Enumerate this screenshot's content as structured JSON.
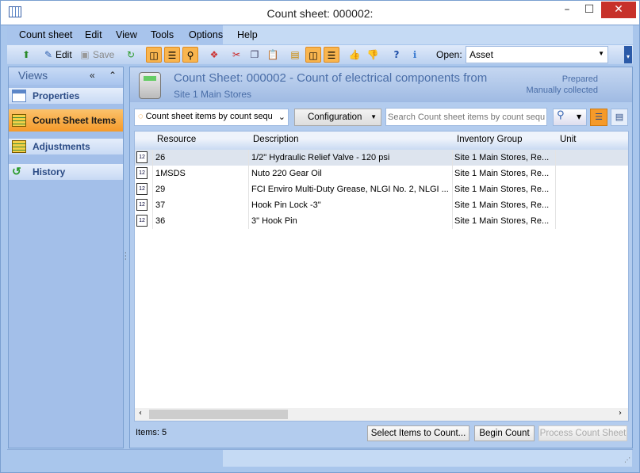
{
  "window": {
    "title": "Count sheet: 000002:",
    "minimize": "–",
    "maximize": "☐",
    "close": "✕"
  },
  "menu": [
    "Count sheet",
    "Edit",
    "View",
    "Tools",
    "Options",
    "Help"
  ],
  "toolbar": {
    "edit": "Edit",
    "save": "Save",
    "open_label": "Open:",
    "open_value": "Asset"
  },
  "views": {
    "title": "Views",
    "items": [
      "Properties",
      "Count Sheet Items",
      "Adjustments",
      "History"
    ]
  },
  "header": {
    "title": "Count Sheet: 000002 - Count of electrical components from",
    "subtitle": "Site 1 Main Stores",
    "status1": "Prepared",
    "status2": "Manually collected"
  },
  "filter": {
    "view_select": "Count sheet items by count sequ",
    "configuration": "Configuration",
    "search_placeholder": "Search Count sheet items by count sequence"
  },
  "grid": {
    "columns": [
      "Resource",
      "Description",
      "Inventory Group",
      "Unit"
    ],
    "rows": [
      {
        "resource": "26",
        "description": "1/2\" Hydraulic Relief Valve - 120 psi",
        "group": "Site 1 Main Stores, Re...",
        "unit": ""
      },
      {
        "resource": "1MSDS",
        "description": "Nuto 220 Gear Oil",
        "group": "Site 1 Main Stores, Re...",
        "unit": ""
      },
      {
        "resource": "29",
        "description": "FCI Enviro Multi-Duty Grease, NLGI No. 2, NLGI ...",
        "group": "Site 1 Main Stores, Re...",
        "unit": ""
      },
      {
        "resource": "37",
        "description": "Hook Pin Lock -3\"",
        "group": "Site 1 Main Stores, Re...",
        "unit": ""
      },
      {
        "resource": "36",
        "description": "3\" Hook Pin",
        "group": "Site 1 Main Stores, Re...",
        "unit": ""
      }
    ],
    "row_icon": "12"
  },
  "footer": {
    "items": "Items: 5",
    "select": "Select Items to Count...",
    "begin": "Begin Count",
    "process": "Process Count Sheet"
  }
}
